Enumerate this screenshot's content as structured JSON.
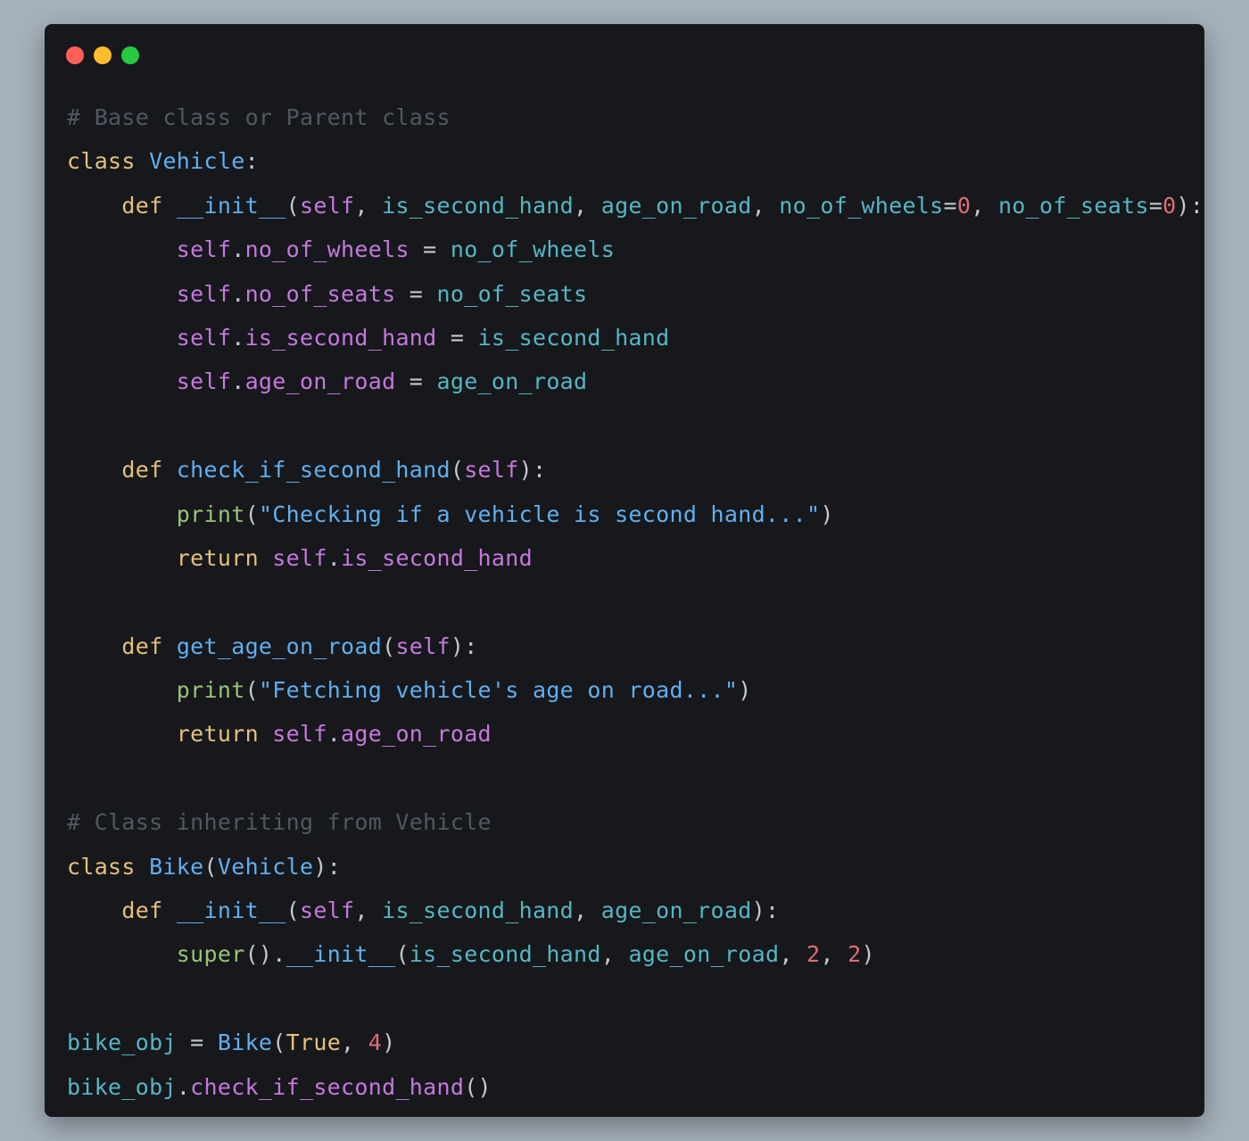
{
  "window": {
    "traffic_lights": [
      {
        "name": "close",
        "color": "#ff5f57"
      },
      {
        "name": "minimize",
        "color": "#febc2e"
      },
      {
        "name": "zoom",
        "color": "#28c840"
      }
    ]
  },
  "colors": {
    "comment": "#5c6370",
    "keyword": "#e5c07b",
    "class_name": "#61afef",
    "function": "#61afef",
    "identifier": "#56b6c2",
    "self": "#c678dd",
    "attribute": "#c678dd",
    "string": "#61afef",
    "number": "#e06c75",
    "builtin": "#98c379",
    "punctuation": "#c5c8ce"
  },
  "code": {
    "language": "python",
    "lines": [
      [
        {
          "t": "# Base class or Parent class",
          "c": "comment"
        }
      ],
      [
        {
          "t": "class ",
          "c": "keyword"
        },
        {
          "t": "Vehicle",
          "c": "class_name"
        },
        {
          "t": ":",
          "c": "punctuation"
        }
      ],
      [
        {
          "t": "    def ",
          "c": "keyword"
        },
        {
          "t": "__init__",
          "c": "function"
        },
        {
          "t": "(",
          "c": "punctuation"
        },
        {
          "t": "self",
          "c": "self"
        },
        {
          "t": ", ",
          "c": "punctuation"
        },
        {
          "t": "is_second_hand",
          "c": "identifier"
        },
        {
          "t": ", ",
          "c": "punctuation"
        },
        {
          "t": "age_on_road",
          "c": "identifier"
        },
        {
          "t": ", ",
          "c": "punctuation"
        },
        {
          "t": "no_of_wheels",
          "c": "identifier"
        },
        {
          "t": "=",
          "c": "punctuation"
        },
        {
          "t": "0",
          "c": "number"
        },
        {
          "t": ", ",
          "c": "punctuation"
        },
        {
          "t": "no_of_seats",
          "c": "identifier"
        },
        {
          "t": "=",
          "c": "punctuation"
        },
        {
          "t": "0",
          "c": "number"
        },
        {
          "t": "):",
          "c": "punctuation"
        }
      ],
      [
        {
          "t": "        self",
          "c": "self"
        },
        {
          "t": ".",
          "c": "punctuation"
        },
        {
          "t": "no_of_wheels",
          "c": "attribute"
        },
        {
          "t": " = ",
          "c": "punctuation"
        },
        {
          "t": "no_of_wheels",
          "c": "identifier"
        }
      ],
      [
        {
          "t": "        self",
          "c": "self"
        },
        {
          "t": ".",
          "c": "punctuation"
        },
        {
          "t": "no_of_seats",
          "c": "attribute"
        },
        {
          "t": " = ",
          "c": "punctuation"
        },
        {
          "t": "no_of_seats",
          "c": "identifier"
        }
      ],
      [
        {
          "t": "        self",
          "c": "self"
        },
        {
          "t": ".",
          "c": "punctuation"
        },
        {
          "t": "is_second_hand",
          "c": "attribute"
        },
        {
          "t": " = ",
          "c": "punctuation"
        },
        {
          "t": "is_second_hand",
          "c": "identifier"
        }
      ],
      [
        {
          "t": "        self",
          "c": "self"
        },
        {
          "t": ".",
          "c": "punctuation"
        },
        {
          "t": "age_on_road",
          "c": "attribute"
        },
        {
          "t": " = ",
          "c": "punctuation"
        },
        {
          "t": "age_on_road",
          "c": "identifier"
        }
      ],
      [],
      [
        {
          "t": "    def ",
          "c": "keyword"
        },
        {
          "t": "check_if_second_hand",
          "c": "function"
        },
        {
          "t": "(",
          "c": "punctuation"
        },
        {
          "t": "self",
          "c": "self"
        },
        {
          "t": "):",
          "c": "punctuation"
        }
      ],
      [
        {
          "t": "        print",
          "c": "builtin"
        },
        {
          "t": "(",
          "c": "punctuation"
        },
        {
          "t": "\"Checking if a vehicle is second hand...\"",
          "c": "string"
        },
        {
          "t": ")",
          "c": "punctuation"
        }
      ],
      [
        {
          "t": "        return ",
          "c": "keyword"
        },
        {
          "t": "self",
          "c": "self"
        },
        {
          "t": ".",
          "c": "punctuation"
        },
        {
          "t": "is_second_hand",
          "c": "attribute"
        }
      ],
      [],
      [
        {
          "t": "    def ",
          "c": "keyword"
        },
        {
          "t": "get_age_on_road",
          "c": "function"
        },
        {
          "t": "(",
          "c": "punctuation"
        },
        {
          "t": "self",
          "c": "self"
        },
        {
          "t": "):",
          "c": "punctuation"
        }
      ],
      [
        {
          "t": "        print",
          "c": "builtin"
        },
        {
          "t": "(",
          "c": "punctuation"
        },
        {
          "t": "\"Fetching vehicle's age on road...\"",
          "c": "string"
        },
        {
          "t": ")",
          "c": "punctuation"
        }
      ],
      [
        {
          "t": "        return ",
          "c": "keyword"
        },
        {
          "t": "self",
          "c": "self"
        },
        {
          "t": ".",
          "c": "punctuation"
        },
        {
          "t": "age_on_road",
          "c": "attribute"
        }
      ],
      [],
      [
        {
          "t": "# Class inheriting from Vehicle",
          "c": "comment"
        }
      ],
      [
        {
          "t": "class ",
          "c": "keyword"
        },
        {
          "t": "Bike",
          "c": "class_name"
        },
        {
          "t": "(",
          "c": "punctuation"
        },
        {
          "t": "Vehicle",
          "c": "class_name"
        },
        {
          "t": "):",
          "c": "punctuation"
        }
      ],
      [
        {
          "t": "    def ",
          "c": "keyword"
        },
        {
          "t": "__init__",
          "c": "function"
        },
        {
          "t": "(",
          "c": "punctuation"
        },
        {
          "t": "self",
          "c": "self"
        },
        {
          "t": ", ",
          "c": "punctuation"
        },
        {
          "t": "is_second_hand",
          "c": "identifier"
        },
        {
          "t": ", ",
          "c": "punctuation"
        },
        {
          "t": "age_on_road",
          "c": "identifier"
        },
        {
          "t": "):",
          "c": "punctuation"
        }
      ],
      [
        {
          "t": "        super",
          "c": "builtin"
        },
        {
          "t": "().",
          "c": "punctuation"
        },
        {
          "t": "__init__",
          "c": "function"
        },
        {
          "t": "(",
          "c": "punctuation"
        },
        {
          "t": "is_second_hand",
          "c": "identifier"
        },
        {
          "t": ", ",
          "c": "punctuation"
        },
        {
          "t": "age_on_road",
          "c": "identifier"
        },
        {
          "t": ", ",
          "c": "punctuation"
        },
        {
          "t": "2",
          "c": "number"
        },
        {
          "t": ", ",
          "c": "punctuation"
        },
        {
          "t": "2",
          "c": "number"
        },
        {
          "t": ")",
          "c": "punctuation"
        }
      ],
      [],
      [
        {
          "t": "bike_obj",
          "c": "identifier"
        },
        {
          "t": " = ",
          "c": "punctuation"
        },
        {
          "t": "Bike",
          "c": "class_name"
        },
        {
          "t": "(",
          "c": "punctuation"
        },
        {
          "t": "True",
          "c": "keyword"
        },
        {
          "t": ", ",
          "c": "punctuation"
        },
        {
          "t": "4",
          "c": "number"
        },
        {
          "t": ")",
          "c": "punctuation"
        }
      ],
      [
        {
          "t": "bike_obj",
          "c": "identifier"
        },
        {
          "t": ".",
          "c": "punctuation"
        },
        {
          "t": "check_if_second_hand",
          "c": "attribute"
        },
        {
          "t": "()",
          "c": "punctuation"
        }
      ]
    ]
  }
}
